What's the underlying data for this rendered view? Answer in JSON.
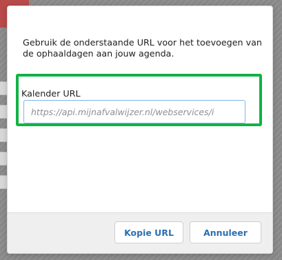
{
  "dialog": {
    "intro": "Gebruik de onderstaande URL voor het toevoegen van de ophaaldagen aan jouw agenda.",
    "field_label": "Kalender URL",
    "url_value": "https://api.mijnafvalwijzer.nl/webservices/i",
    "buttons": {
      "copy": "Kopie URL",
      "cancel": "Annuleer"
    }
  },
  "colors": {
    "highlight": "#11b345",
    "button_text": "#2a6fb3",
    "input_border": "#7fb6e6"
  }
}
